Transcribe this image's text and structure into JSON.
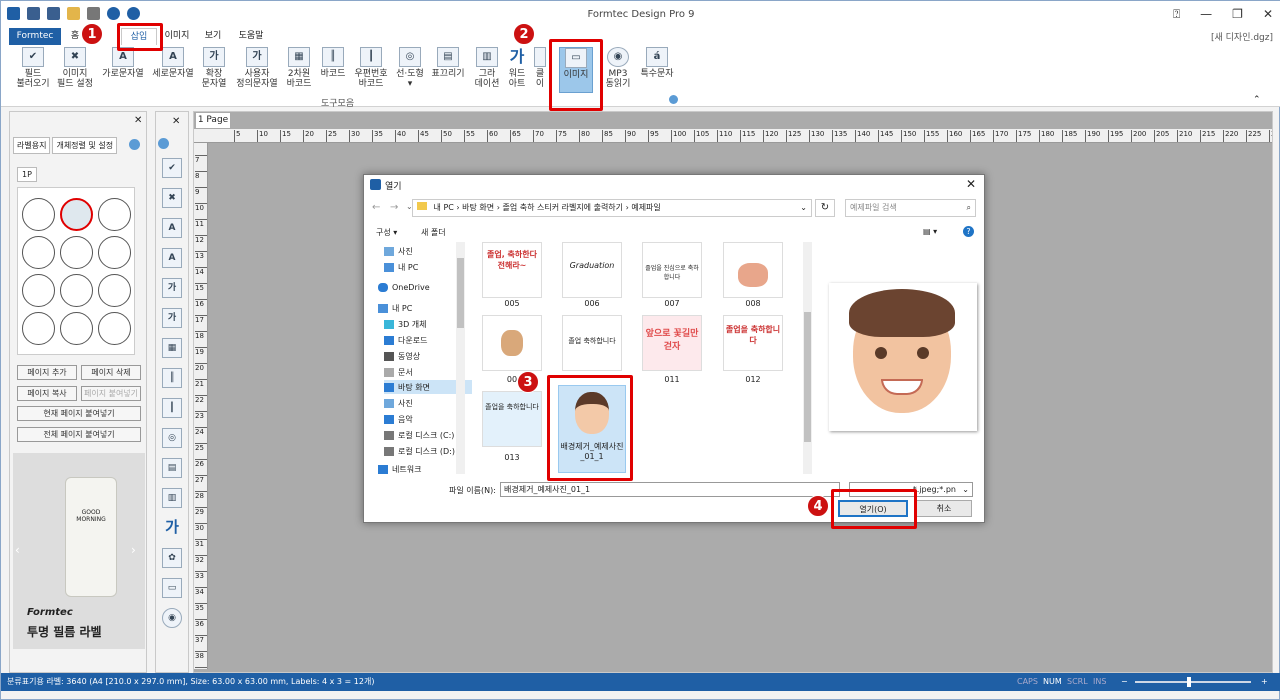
{
  "app": {
    "title": "Formtec Design Pro 9",
    "filename": "[새 디자인.dgz]"
  },
  "tabs": {
    "file": "Formtec",
    "home": "홈",
    "insert": "삽입",
    "image": "이미지",
    "view": "보기",
    "help": "도움말"
  },
  "ribbon": {
    "items": [
      "필드\n불러오기",
      "이미지\n필드 설정",
      "가로문자열",
      "세로문자열",
      "확장\n문자열",
      "사용자\n정의문자열",
      "2차원\n바코드",
      "바코드",
      "우편번호\n바코드",
      "선·도형",
      "표끄리기",
      "그라\n데이션",
      "워드\n아트",
      "클\n이",
      "이미지",
      "MP3\n동읽기",
      "특수문자"
    ],
    "group_label": "도구모음"
  },
  "callouts": {
    "one": "1",
    "two": "2",
    "three": "3",
    "four": "4"
  },
  "panel": {
    "tab1": "라벨용지",
    "tab2": "개체정렬 및 설정",
    "page": "1P",
    "add_page": "페이지 추가",
    "delete_page": "페이지 삭제",
    "copy_page": "페이지 복사",
    "paste_page": "페이지 붙여넣기",
    "paste_current": "현재 페이지 붙여넣기",
    "paste_all": "전체 페이지 붙여넣기",
    "ad_brand": "Formtec",
    "ad_text": "투명 필름 라벨",
    "ad_bottle": "GOOD MORNING"
  },
  "canvas": {
    "page_tab": "1 Page"
  },
  "ruler_ticks": [
    "5",
    "10",
    "15",
    "20",
    "25",
    "30",
    "35",
    "40",
    "45",
    "50",
    "55",
    "60",
    "65",
    "70",
    "75",
    "80",
    "85",
    "90",
    "95",
    "100",
    "105",
    "110",
    "115",
    "120",
    "125",
    "130",
    "135",
    "140",
    "145",
    "150",
    "155",
    "160",
    "165",
    "170",
    "175",
    "180",
    "185",
    "190",
    "195",
    "200",
    "205",
    "210",
    "215",
    "220",
    "225",
    "230"
  ],
  "vruler_ticks": [
    "7",
    "8",
    "9",
    "10",
    "11",
    "12",
    "13",
    "14",
    "15",
    "16",
    "17",
    "18",
    "19",
    "20",
    "21",
    "22",
    "23",
    "24",
    "25",
    "26",
    "27",
    "28",
    "29",
    "30",
    "31",
    "32",
    "33",
    "34",
    "35",
    "36",
    "37",
    "38",
    "39"
  ],
  "dialog": {
    "title": "열기",
    "breadcrumb": [
      "내 PC",
      "바탕 화면",
      "졸업 축하 스티커 라벨지에 출력하기",
      "예제파일"
    ],
    "search_placeholder": "예제파일 검색",
    "organize": "구성 ▾",
    "new_folder": "새 폴더",
    "nav": [
      "사진",
      "내 PC",
      "OneDrive",
      "내 PC",
      "3D 개체",
      "다운로드",
      "동영상",
      "문서",
      "바탕 화면",
      "사진",
      "음악",
      "로컬 디스크 (C:)",
      "로컬 디스크 (D:)",
      "네트워크"
    ],
    "files": [
      {
        "name": "005",
        "text": "졸업, 축하한다 전해라~"
      },
      {
        "name": "006",
        "text": "Graduation"
      },
      {
        "name": "007",
        "text": "졸업을 진심으로 축하합니다"
      },
      {
        "name": "008",
        "text": ""
      },
      {
        "name": "009",
        "text": ""
      },
      {
        "name": "010",
        "text": "졸업 축하합니다"
      },
      {
        "name": "011",
        "text": "앞으로 꽃길만 걷자"
      },
      {
        "name": "012",
        "text": "졸업을 축하합니다"
      },
      {
        "name": "013",
        "text": "졸업을 축하합니다"
      },
      {
        "name": "배경제거_예제사진_01_1",
        "text": ""
      }
    ],
    "filename_label": "파일 이름(N):",
    "filename_value": "배경제거_예제사진_01_1",
    "filetype": "*.jpeg;*.pn",
    "open_btn": "열기(O)",
    "cancel_btn": "취소"
  },
  "status": {
    "text": "분류표기용 라벨: 3640 (A4 [210.0 x 297.0 mm], Size: 63.00 x 63.00 mm,  Labels: 4 x 3 = 12개)",
    "caps": "CAPS",
    "num": "NUM",
    "scrl": "SCRL",
    "ins": "INS"
  }
}
